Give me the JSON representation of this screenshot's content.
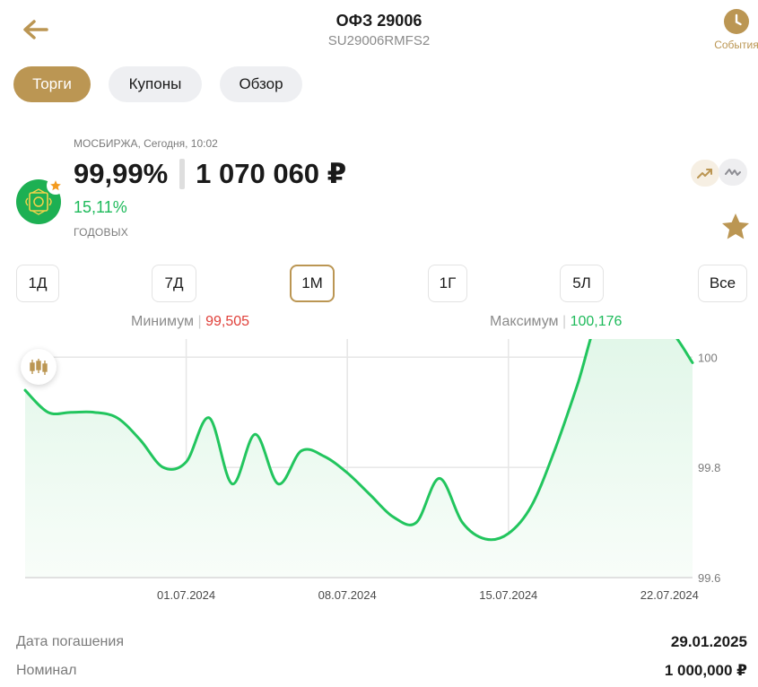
{
  "header": {
    "title": "ОФЗ 29006",
    "subtitle": "SU29006RMFS2",
    "events_label": "События"
  },
  "tabs": [
    {
      "label": "Торги",
      "active": true
    },
    {
      "label": "Купоны",
      "active": false
    },
    {
      "label": "Обзор",
      "active": false
    }
  ],
  "quote": {
    "exchange_line": "МОСБИРЖА, Сегодня, 10:02",
    "price_percent": "99,99%",
    "price_rub": "1 070 060 ₽",
    "yield": "15,11%",
    "yield_label": "ГОДОВЫХ"
  },
  "periods": [
    {
      "label": "1Д",
      "active": false
    },
    {
      "label": "7Д",
      "active": false
    },
    {
      "label": "1М",
      "active": true
    },
    {
      "label": "1Г",
      "active": false
    },
    {
      "label": "5Л",
      "active": false
    },
    {
      "label": "Все",
      "active": false
    }
  ],
  "range": {
    "min_label": "Минимум",
    "min_value": "99,505",
    "max_label": "Максимум",
    "max_value": "100,176"
  },
  "chart_data": {
    "type": "area",
    "x_tick_labels": [
      "01.07.2024",
      "08.07.2024",
      "15.07.2024",
      "22.07.2024"
    ],
    "y_tick_labels": [
      "100",
      "99.8",
      "99.6"
    ],
    "ylim": [
      99.6,
      100.02
    ],
    "grid": true,
    "series": [
      {
        "x": [
          "2024-06-24",
          "2024-06-25",
          "2024-06-26",
          "2024-06-27",
          "2024-06-28",
          "2024-06-29",
          "2024-06-30",
          "2024-07-01",
          "2024-07-02",
          "2024-07-03",
          "2024-07-04",
          "2024-07-05",
          "2024-07-06",
          "2024-07-07",
          "2024-07-08",
          "2024-07-09",
          "2024-07-10",
          "2024-07-11",
          "2024-07-12",
          "2024-07-13",
          "2024-07-14",
          "2024-07-15",
          "2024-07-16",
          "2024-07-17",
          "2024-07-18",
          "2024-07-19",
          "2024-07-20",
          "2024-07-21",
          "2024-07-22",
          "2024-07-23"
        ],
        "y": [
          99.94,
          99.9,
          99.9,
          99.9,
          99.89,
          99.85,
          99.8,
          99.81,
          99.89,
          99.77,
          99.86,
          99.77,
          99.83,
          99.82,
          99.79,
          99.75,
          99.71,
          99.7,
          99.78,
          99.7,
          99.67,
          99.68,
          99.73,
          99.83,
          99.95,
          100.08,
          100.06,
          100.06,
          100.05,
          99.99
        ]
      }
    ],
    "colors": {
      "line": "#22c55e",
      "area": "#e6f8ec"
    }
  },
  "details": [
    {
      "label": "Дата погашения",
      "value": "29.01.2025"
    },
    {
      "label": "Номинал",
      "value": "1 000,000 ₽"
    }
  ],
  "colors": {
    "accent": "#bb9653",
    "positive": "#1dba5a",
    "negative": "#e0403a"
  },
  "icons": {
    "back": "arrow-left-icon",
    "events": "clock-icon",
    "favorite": "star-icon",
    "candles": "candlestick-icon"
  }
}
